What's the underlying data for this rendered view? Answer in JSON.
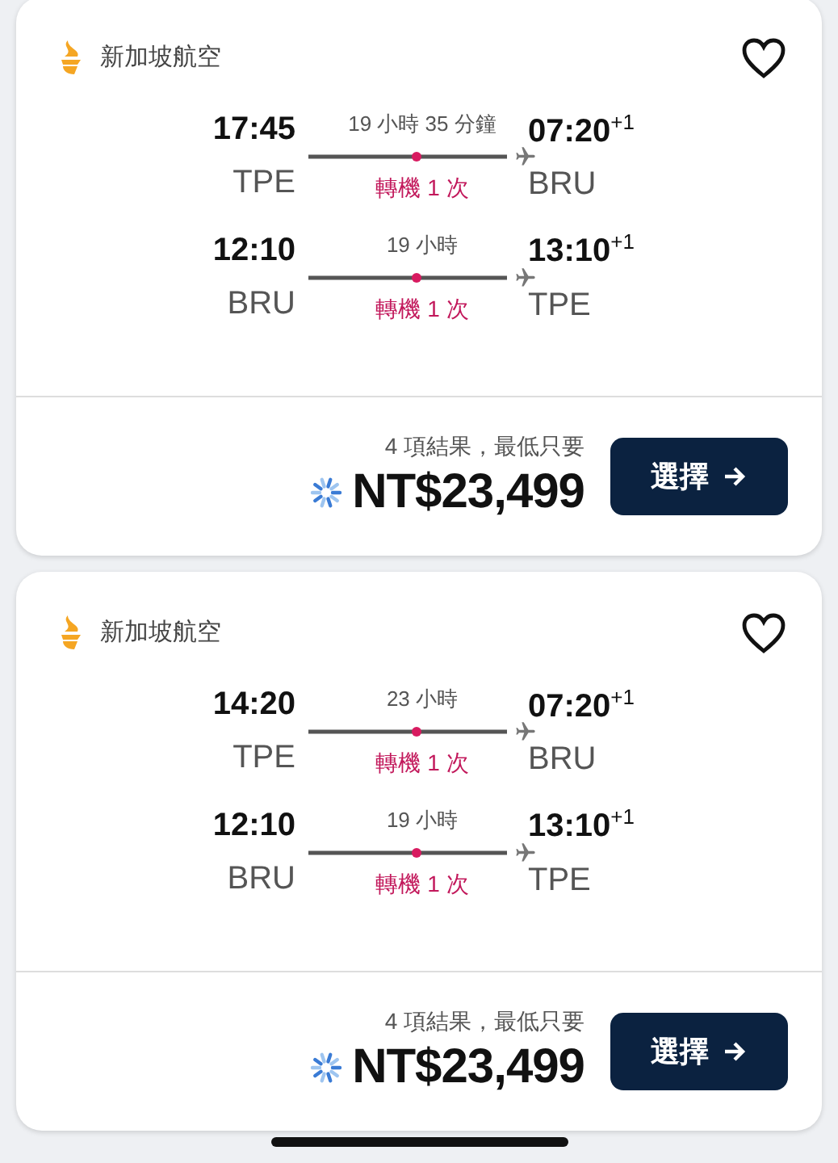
{
  "results": [
    {
      "airline": "新加坡航空",
      "favorite": false,
      "legs": [
        {
          "depart_time": "17:45",
          "depart_code": "TPE",
          "duration": "19 小時 35 分鐘",
          "stops": "轉機 1 次",
          "arrive_time": "07:20",
          "day_offset": "+1",
          "arrive_code": "BRU"
        },
        {
          "depart_time": "12:10",
          "depart_code": "BRU",
          "duration": "19 小時",
          "stops": "轉機 1 次",
          "arrive_time": "13:10",
          "day_offset": "+1",
          "arrive_code": "TPE"
        }
      ],
      "summary": "4 項結果，最低只要",
      "price": "NT$23,499",
      "button": "選擇"
    },
    {
      "airline": "新加坡航空",
      "favorite": false,
      "legs": [
        {
          "depart_time": "14:20",
          "depart_code": "TPE",
          "duration": "23 小時",
          "stops": "轉機 1 次",
          "arrive_time": "07:20",
          "day_offset": "+1",
          "arrive_code": "BRU"
        },
        {
          "depart_time": "12:10",
          "depart_code": "BRU",
          "duration": "19 小時",
          "stops": "轉機 1 次",
          "arrive_time": "13:10",
          "day_offset": "+1",
          "arrive_code": "TPE"
        }
      ],
      "summary": "4 項結果，最低只要",
      "price": "NT$23,499",
      "button": "選擇"
    }
  ]
}
